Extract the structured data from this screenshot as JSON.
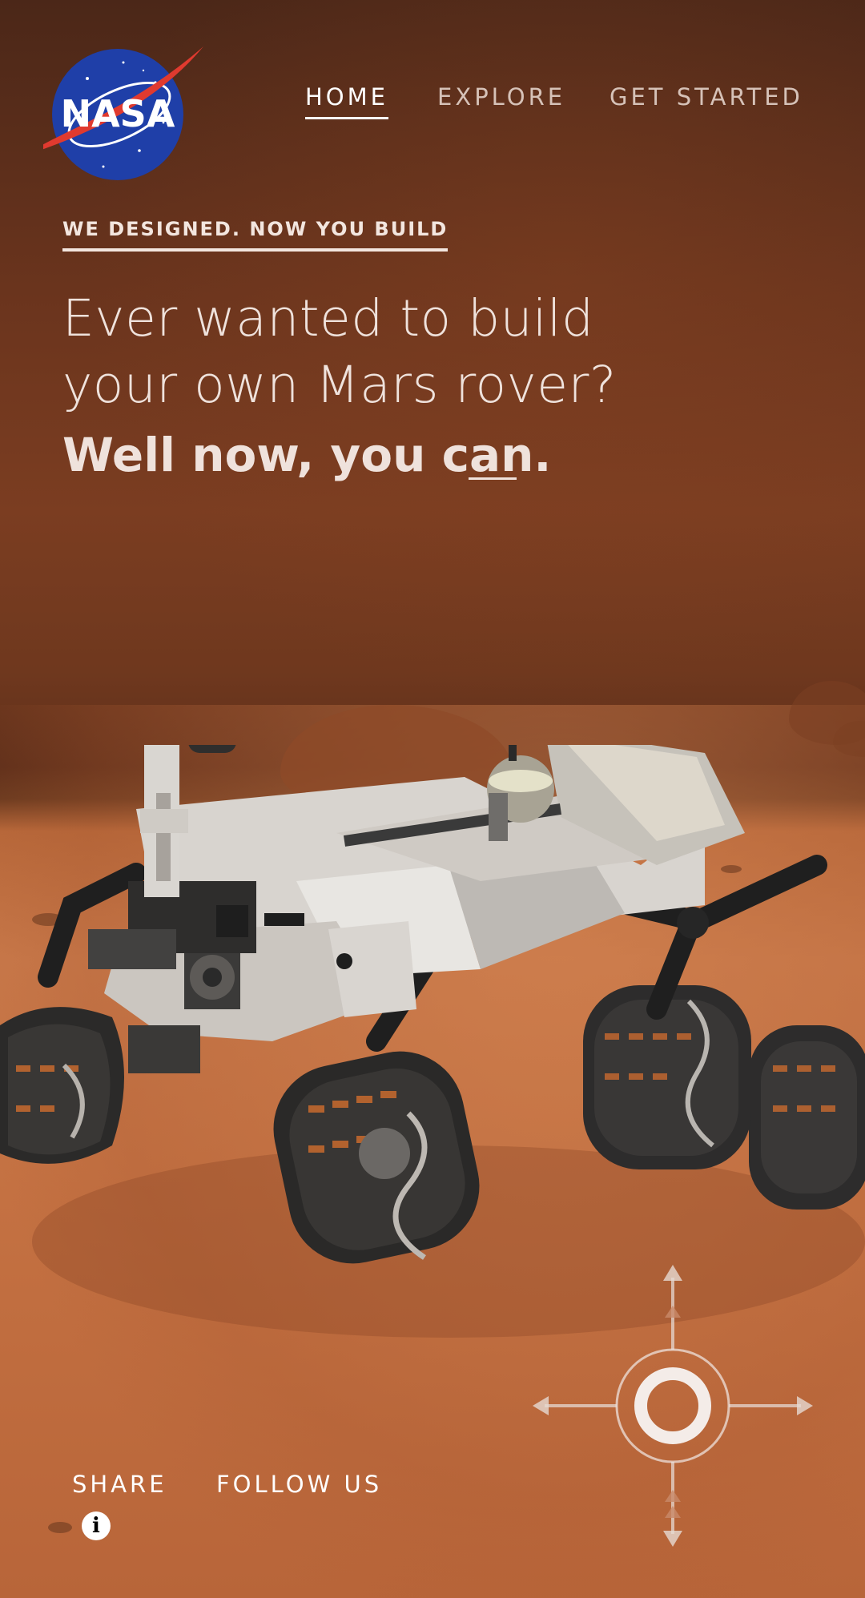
{
  "brand": {
    "logo_text": "NASA"
  },
  "nav": {
    "items": [
      {
        "label": "HOME",
        "active": true
      },
      {
        "label": "EXPLORE",
        "active": false
      },
      {
        "label": "GET STARTED",
        "active": false
      }
    ]
  },
  "hero": {
    "kicker": "WE DESIGNED. NOW YOU BUILD",
    "headline_line1": "Ever wanted to build",
    "headline_line2": "your own Mars rover?",
    "headline_bold": "Well now, you can."
  },
  "footer": {
    "share_label": "SHARE",
    "follow_label": "FOLLOW US",
    "info_glyph": "i"
  },
  "controls": {
    "joystick": "joystick-control-icon"
  },
  "colors": {
    "sky": "#6a341d",
    "ground": "#c47142",
    "nasa_blue": "#1f3fa8",
    "nasa_red": "#e03a2f",
    "text": "#efe2dc"
  }
}
